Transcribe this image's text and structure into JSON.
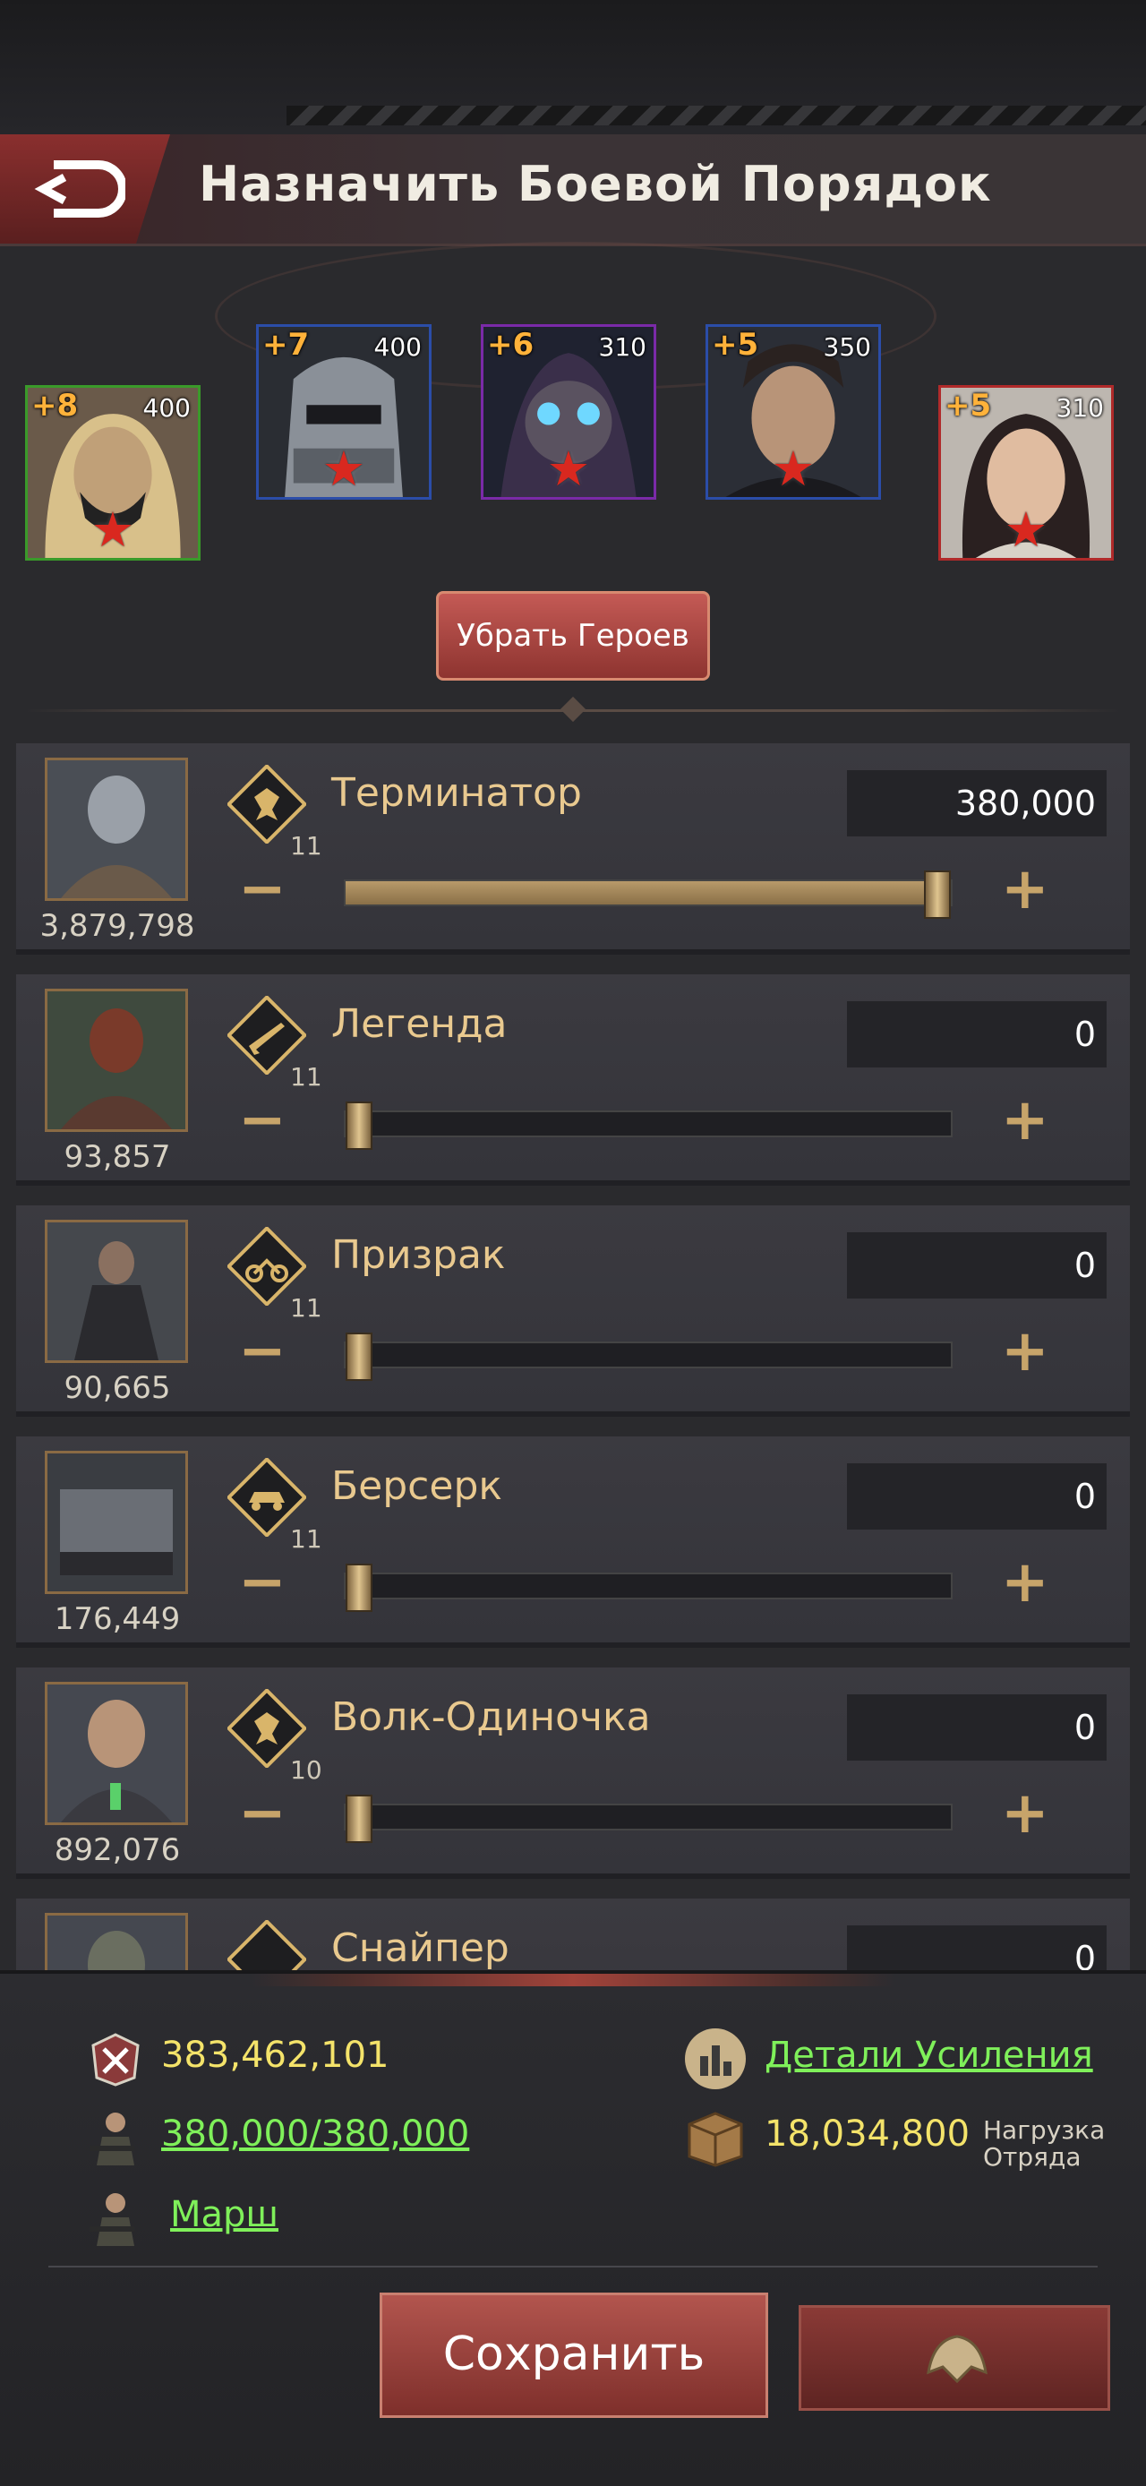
{
  "header": {
    "title": "Назначить Боевой Порядок"
  },
  "heroes": [
    {
      "level": "+8",
      "power": "400",
      "frame": "#3a9a2a"
    },
    {
      "level": "+7",
      "power": "400",
      "frame": "#2b4da8"
    },
    {
      "level": "+6",
      "power": "310",
      "frame": "#7a2aa8"
    },
    {
      "level": "+5",
      "power": "350",
      "frame": "#2b4da8"
    },
    {
      "level": "+5",
      "power": "310",
      "frame": "#b02a2a"
    }
  ],
  "remove_heroes_label": "Убрать Героев",
  "troops": [
    {
      "name": "Терминатор",
      "tier": "11",
      "power": "3,879,798",
      "count": "380,000",
      "fraction": 1.0,
      "icon": "shield-icon"
    },
    {
      "name": "Легенда",
      "tier": "11",
      "power": "93,857",
      "count": "0",
      "fraction": 0,
      "icon": "rifle-icon"
    },
    {
      "name": "Призрак",
      "tier": "11",
      "power": "90,665",
      "count": "0",
      "fraction": 0,
      "icon": "motorcycle-icon"
    },
    {
      "name": "Берсерк",
      "tier": "11",
      "power": "176,449",
      "count": "0",
      "fraction": 0,
      "icon": "car-icon"
    },
    {
      "name": "Волк-Одиночка",
      "tier": "10",
      "power": "892,076",
      "count": "0",
      "fraction": 0,
      "icon": "shield-icon"
    },
    {
      "name": "Снайпер",
      "tier": "",
      "power": "",
      "count": "0",
      "fraction": 0,
      "icon": "shield-icon"
    }
  ],
  "bottom": {
    "total_power": "383,462,101",
    "troop_capacity": "380,000/380,000",
    "march_label": "Марш",
    "boost_details_label": "Детали Усиления",
    "load_value": "18,034,800",
    "load_label_1": "Нагрузка",
    "load_label_2": "Отряда",
    "save_label": "Сохранить"
  },
  "colors": {
    "accent_link": "#7ff05a",
    "value_yellow": "#f4e36a",
    "save_red": "#b2554e"
  }
}
